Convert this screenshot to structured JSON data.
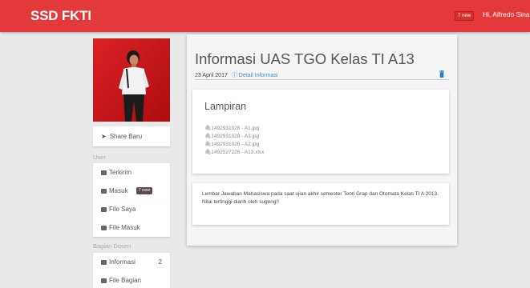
{
  "navbar": {
    "brand": "SSD FKTI",
    "badge": "7 new",
    "user": "Hi, Alfredo Sinag"
  },
  "sidebar": {
    "share_label": "Share Baru",
    "user_section": "User",
    "user_items": [
      {
        "label": "Terkirim"
      },
      {
        "label": "Masuk",
        "badge": "7 new"
      },
      {
        "label": "File Saya"
      },
      {
        "label": "File Masuk"
      }
    ],
    "dosen_section": "Bagian Dosen",
    "dosen_items": [
      {
        "label": "Informasi",
        "count": "2"
      },
      {
        "label": "File Bagian"
      }
    ]
  },
  "post": {
    "title": "Informasi UAS TGO Kelas TI A13",
    "date": "23 April 2017",
    "detail_link": "Detail Informasi",
    "attachments_heading": "Lampiran",
    "files": [
      "1492931028 - A1.jpg",
      "1492931028 - A3.jpg",
      "1492931026 - A2.jpg",
      "1492527226 - A13.xlsx"
    ],
    "description": "Lembar Jawaban Mahasiswa pada saat ujian akhir semester Teori Grap dan Otomata Kelas TI A 2013.",
    "note": "Nilai tertinggi diarih oleh sugeng!!"
  },
  "colors": {
    "navbar": "#e3393a",
    "link": "#3a8fd6",
    "trash": "#2979c9"
  }
}
